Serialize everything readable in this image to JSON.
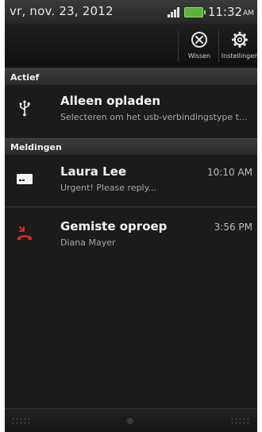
{
  "status_bar": {
    "date": "vr, nov. 23, 2012",
    "time": "11:32",
    "ampm": "AM",
    "battery_color": "#5db33b"
  },
  "toolbar": {
    "clear_label": "Wissen",
    "clear_icon": "close-circle-icon",
    "settings_label": "Instellingen",
    "settings_icon": "gear-icon"
  },
  "sections": {
    "active_header": "Actief",
    "notifications_header": "Meldingen"
  },
  "active": {
    "icon": "usb-icon",
    "title": "Alleen opladen",
    "subtitle": "Selecteren om het usb-verbindingstype t..."
  },
  "notifications": [
    {
      "icon": "message-icon",
      "title": "Laura Lee",
      "subtitle": "Urgent! Please reply...",
      "time": "10:10 AM"
    },
    {
      "icon": "missed-call-icon",
      "title": "Gemiste oproep",
      "subtitle": "Diana Mayer",
      "time": "3:56 PM",
      "icon_color": "#e0261b"
    }
  ]
}
